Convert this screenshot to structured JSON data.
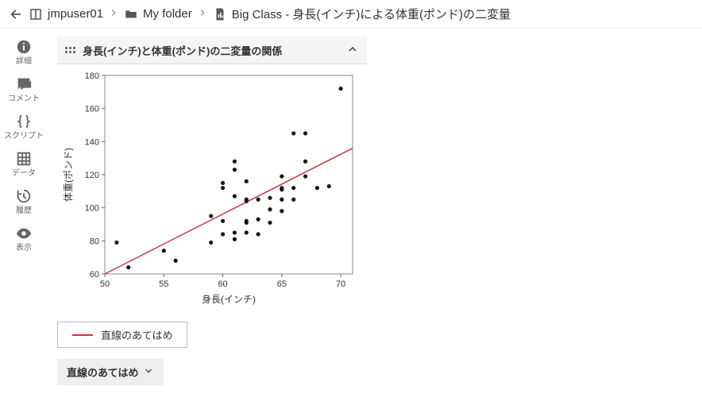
{
  "breadcrumb": {
    "root": "jmpuser01",
    "folder": "My folder",
    "file": "Big Class - 身長(インチ)による体重(ポンド)の二変量"
  },
  "sidebar": {
    "items": [
      {
        "label": "詳細"
      },
      {
        "label": "コメント"
      },
      {
        "label": "スクリプト"
      },
      {
        "label": "データ"
      },
      {
        "label": "履歴"
      },
      {
        "label": "表示"
      }
    ]
  },
  "panel": {
    "title": "身長(インチ)と体重(ポンド)の二変量の関係"
  },
  "legend": {
    "fit_line": "直線のあてはめ"
  },
  "dropdown": {
    "label": "直線のあてはめ"
  },
  "chart_data": {
    "type": "scatter",
    "title": "",
    "xlabel": "身長(インチ)",
    "ylabel": "体重(ポンド)",
    "xlim": [
      50,
      71
    ],
    "ylim": [
      60,
      180
    ],
    "xticks": [
      50,
      55,
      60,
      65,
      70
    ],
    "yticks": [
      60,
      80,
      100,
      120,
      140,
      160,
      180
    ],
    "points": [
      {
        "x": 51,
        "y": 79
      },
      {
        "x": 52,
        "y": 64
      },
      {
        "x": 55,
        "y": 74
      },
      {
        "x": 56,
        "y": 68
      },
      {
        "x": 59,
        "y": 95
      },
      {
        "x": 59,
        "y": 79
      },
      {
        "x": 60,
        "y": 84
      },
      {
        "x": 60,
        "y": 92
      },
      {
        "x": 60,
        "y": 112
      },
      {
        "x": 60,
        "y": 115
      },
      {
        "x": 61,
        "y": 81
      },
      {
        "x": 61,
        "y": 85
      },
      {
        "x": 61,
        "y": 107
      },
      {
        "x": 61,
        "y": 123
      },
      {
        "x": 61,
        "y": 128
      },
      {
        "x": 62,
        "y": 85
      },
      {
        "x": 62,
        "y": 91
      },
      {
        "x": 62,
        "y": 92
      },
      {
        "x": 62,
        "y": 104
      },
      {
        "x": 62,
        "y": 105
      },
      {
        "x": 62,
        "y": 116
      },
      {
        "x": 63,
        "y": 84
      },
      {
        "x": 63,
        "y": 93
      },
      {
        "x": 63,
        "y": 105
      },
      {
        "x": 64,
        "y": 91
      },
      {
        "x": 64,
        "y": 99
      },
      {
        "x": 64,
        "y": 106
      },
      {
        "x": 65,
        "y": 98
      },
      {
        "x": 65,
        "y": 105
      },
      {
        "x": 65,
        "y": 111
      },
      {
        "x": 65,
        "y": 112
      },
      {
        "x": 65,
        "y": 119
      },
      {
        "x": 66,
        "y": 105
      },
      {
        "x": 66,
        "y": 112
      },
      {
        "x": 66,
        "y": 145
      },
      {
        "x": 67,
        "y": 119
      },
      {
        "x": 67,
        "y": 128
      },
      {
        "x": 67,
        "y": 145
      },
      {
        "x": 68,
        "y": 112
      },
      {
        "x": 69,
        "y": 113
      },
      {
        "x": 70,
        "y": 172
      }
    ],
    "fit_line": {
      "x0": 50,
      "y0": 60,
      "x1": 71,
      "y1": 136,
      "color": "#cc3344"
    }
  }
}
